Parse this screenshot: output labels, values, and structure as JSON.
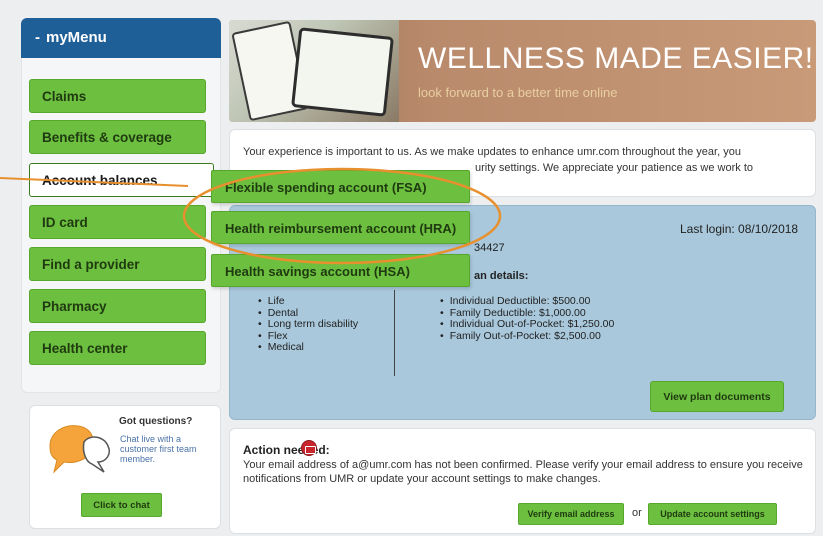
{
  "menu": {
    "title": "myMenu",
    "items": [
      {
        "label": "Claims"
      },
      {
        "label": "Benefits & coverage"
      },
      {
        "label": "Account balances"
      },
      {
        "label": "ID card"
      },
      {
        "label": "Find a provider"
      },
      {
        "label": "Pharmacy"
      },
      {
        "label": "Health center"
      }
    ],
    "submenu": [
      {
        "label": "Flexible spending account (FSA)"
      },
      {
        "label": "Health reimbursement account (HRA)"
      },
      {
        "label": "Health savings account (HSA)"
      }
    ]
  },
  "questions": {
    "title": "Got questions?",
    "text": "Chat live with a customer first team member.",
    "chat_button": "Click to chat"
  },
  "banner": {
    "title": "WELLNESS MADE EASIER!",
    "subtitle": "look forward to a better time online"
  },
  "notice": {
    "line1": "Your experience is important to us. As we make updates to enhance umr.com throughout the year, you",
    "line2": "urity settings. We appreciate your patience as we work to"
  },
  "plan": {
    "last_login": "Last login: 08/10/2018",
    "member_id_fragment": "34427",
    "details_heading_fragment": "an details:",
    "coverage": [
      "Life",
      "Dental",
      "Long term disability",
      "Flex",
      "Medical"
    ],
    "details": [
      "Individual Deductible: $500.00",
      "Family Deductible: $1,000.00",
      "Individual Out-of-Pocket: $1,250.00",
      "Family Out-of-Pocket: $2,500.00"
    ],
    "view_docs_button": "View plan documents"
  },
  "action": {
    "title": "Action needed:",
    "text": "Your email address of a@umr.com has not been confirmed. Please verify your email address to ensure you receive notifications from UMR or update your account settings to make changes.",
    "verify_button": "Verify email address",
    "or_text": "or",
    "update_button": "Update account settings"
  },
  "colors": {
    "menu_header": "#1f5f97",
    "green_button": "#6cbf3f",
    "plan_panel": "#a9c8dc",
    "highlight": "#e8902e",
    "alert": "#c8262c"
  }
}
